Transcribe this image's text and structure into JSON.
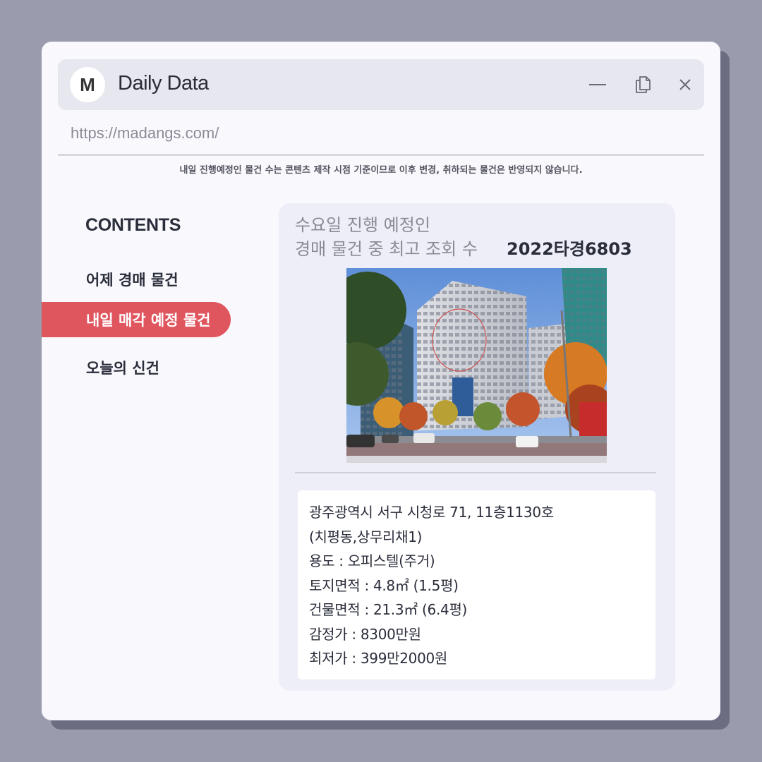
{
  "window": {
    "logo_letter": "M",
    "title": "Daily Data",
    "address": "https://madangs.com/",
    "notice": "내일 진행예정인 물건 수는 콘텐츠 제작 시점 기준이므로 이후 변경, 취하되는 물건은 반영되지 않습니다."
  },
  "icons": {
    "minimize": "minimize-icon",
    "restore": "copy-icon",
    "close": "close-icon"
  },
  "sidebar": {
    "title": "CONTENTS",
    "items": [
      {
        "label": "어제 경매 물건",
        "active": false
      },
      {
        "label": "내일 매각 예정 물건",
        "active": true
      },
      {
        "label": "오늘의 신건",
        "active": false
      }
    ]
  },
  "card": {
    "heading_line1": "수요일 진행 예정인",
    "heading_line2": "경매 물건 중 최고 조회 수",
    "case_number": "2022타경6803",
    "details": [
      "광주광역시 서구 시청로 71, 11층1130호",
      "(치평동,상무리채1)",
      "용도 : 오피스텔(주거)",
      "토지면적 : 4.8㎡ (1.5평)",
      "건물면적 : 21.3㎡ (6.4평)",
      "감정가 : 8300만원",
      "최저가 : 399만2000원"
    ]
  },
  "colors": {
    "background": "#9a9bad",
    "accent": "#e0565f",
    "window": "#f8f8fd",
    "card": "#eeeef8"
  }
}
